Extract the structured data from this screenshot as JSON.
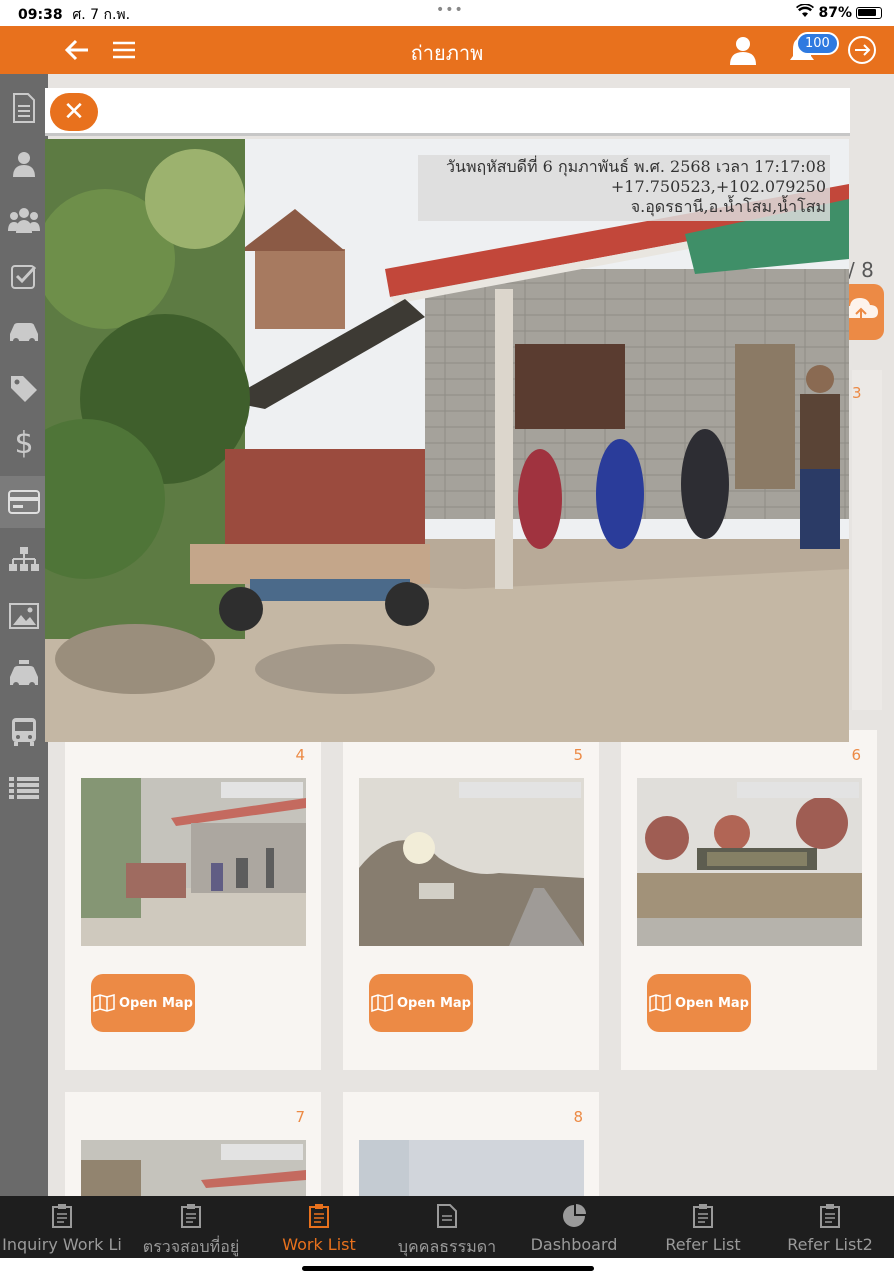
{
  "status_bar": {
    "time": "09:38",
    "date": "ศ. 7 ก.พ.",
    "dots": "•••",
    "battery": "87%"
  },
  "header": {
    "title": "ถ่ายภาพ",
    "notifications_count": "100"
  },
  "sidebar": {
    "icons": [
      "document-icon",
      "user-icon",
      "group-icon",
      "checkbox-icon",
      "car-icon",
      "tag-icon",
      "dollar-icon",
      "card-icon",
      "org-chart-icon",
      "image-icon",
      "taxi-icon",
      "bus-icon",
      "list-icon"
    ]
  },
  "gallery": {
    "page_count": "/ 8",
    "cards": [
      {
        "num": "4",
        "map_label": "Open Map"
      },
      {
        "num": "5",
        "map_label": "Open Map"
      },
      {
        "num": "6",
        "map_label": "Open Map"
      },
      {
        "num": "7"
      },
      {
        "num": "8"
      }
    ],
    "hidden_num": "3"
  },
  "modal": {
    "close_label": "✕",
    "caption_line1": "วันพฤหัสบดีที่ 6 กุมภาพันธ์ พ.ศ. 2568 เวลา 17:17:08",
    "caption_line2": "+17.750523,+102.079250",
    "caption_line3": "จ.อุดรธานี,อ.น้ำโสม,น้ำโสม"
  },
  "tabbar": {
    "tabs": [
      {
        "label": "Inquiry Work Li",
        "active": false
      },
      {
        "label": "ตรวจสอบที่อยู่",
        "active": false
      },
      {
        "label": "Work List",
        "active": true
      },
      {
        "label": "บุคคลธรรมดา",
        "active": false
      },
      {
        "label": "Dashboard",
        "active": false
      },
      {
        "label": "Refer List",
        "active": false
      },
      {
        "label": "Refer List2",
        "active": false
      }
    ]
  },
  "colors": {
    "accent": "#e8711d",
    "sidebar": "#4a4a4a",
    "badge": "#2f7ae0",
    "tabbar": "#1e1e1e"
  }
}
